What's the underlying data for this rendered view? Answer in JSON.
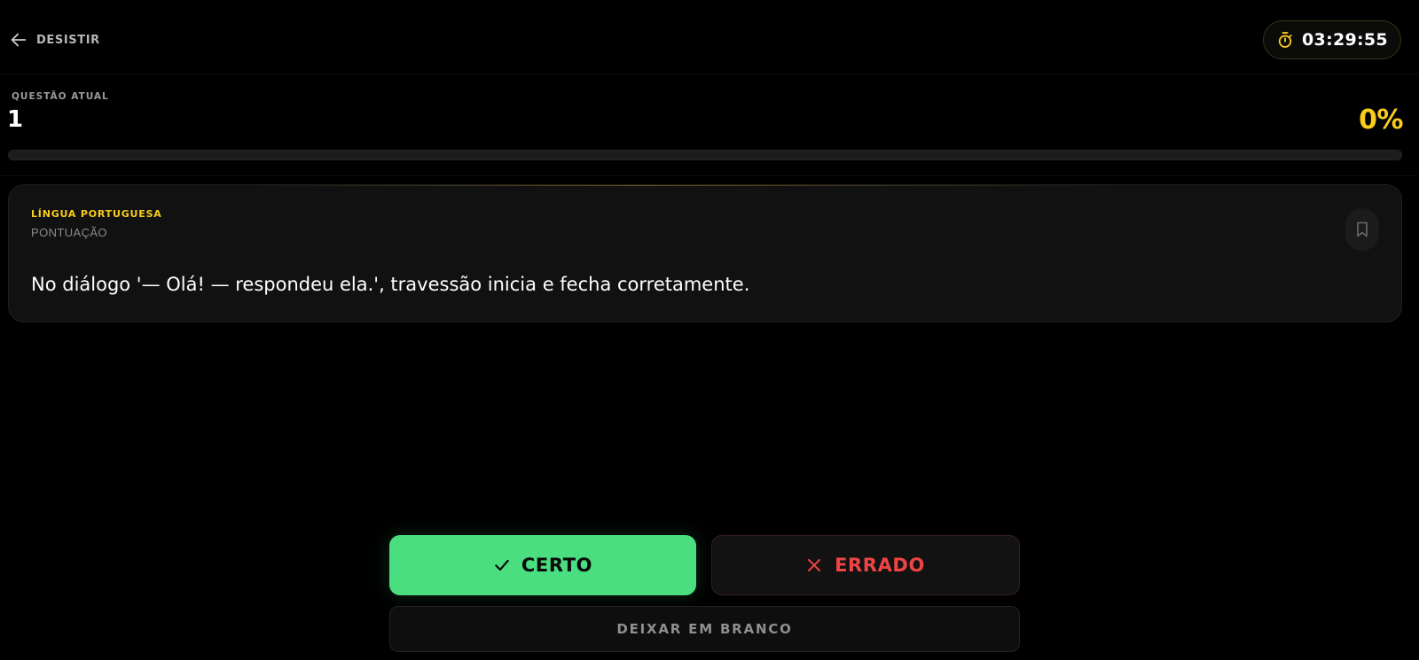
{
  "header": {
    "back_label": "DESISTIR",
    "timer": "03:29:55"
  },
  "progress": {
    "label": "QUESTÃO ATUAL",
    "current_question": "1",
    "percent_label": "0%",
    "percent_value": 0
  },
  "question": {
    "subject": "LÍNGUA PORTUGUESA",
    "topic": "PONTUAÇÃO",
    "statement": "No diálogo '— Olá! — respondeu ela.', travessão inicia e fecha corretamente."
  },
  "answers": {
    "certo_label": "CERTO",
    "errado_label": "ERRADO",
    "blank_label": "DEIXAR EM BRANCO"
  },
  "colors": {
    "accent": "#f8cd1c",
    "correct": "#4ade80",
    "wrong": "#ef4444",
    "background": "#000000",
    "card": "#111111"
  },
  "icons": {
    "back": "arrow-left-icon",
    "timer": "stopwatch-icon",
    "bookmark": "bookmark-icon",
    "certo": "check-icon",
    "errado": "x-icon"
  }
}
